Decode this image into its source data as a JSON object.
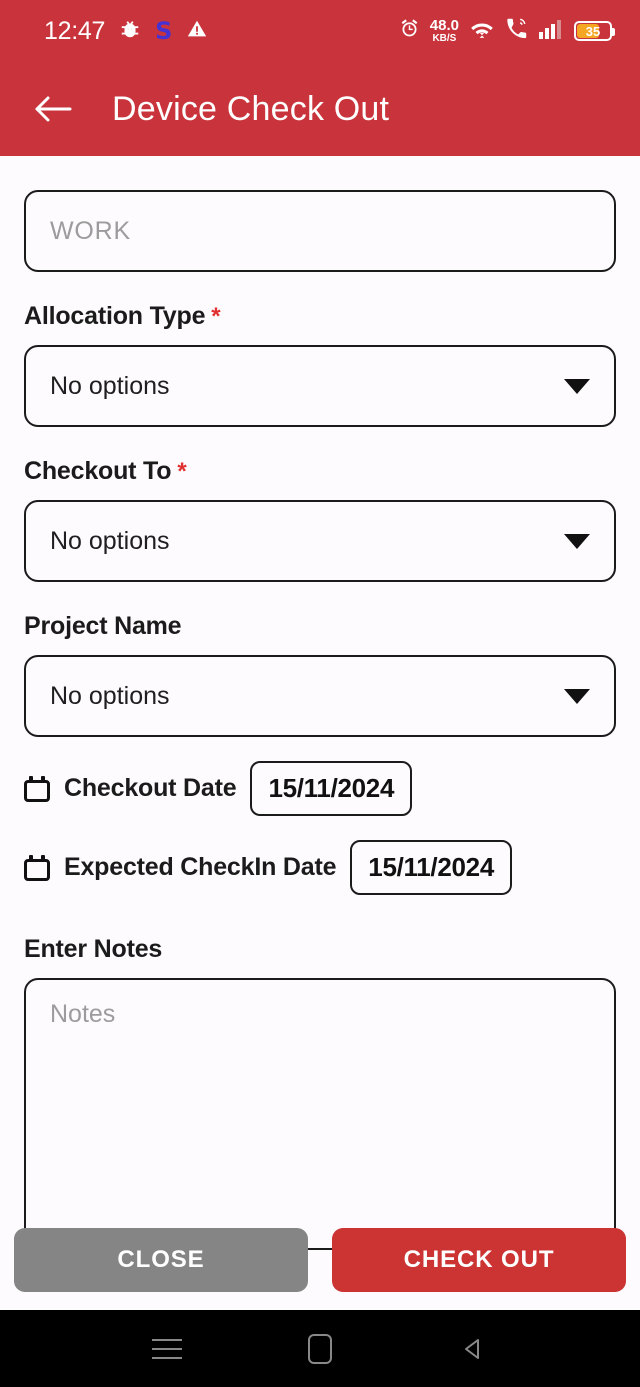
{
  "statusbar": {
    "time": "12:47",
    "icons": [
      "bug-icon",
      "samsung-pass-icon",
      "warning-icon"
    ],
    "network_speed_value": "48.0",
    "network_speed_unit": "KB/S",
    "right_icons": [
      "alarm-icon",
      "wifi-icon",
      "call-icon",
      "signal-icon"
    ],
    "battery_percent": "35"
  },
  "appbar": {
    "back_label": "←",
    "title": "Device Check Out"
  },
  "form": {
    "work_field": {
      "placeholder": "WORK",
      "value": ""
    },
    "allocation_type": {
      "label": "Allocation Type",
      "required_marker": "*",
      "value": "No options"
    },
    "checkout_to": {
      "label": "Checkout To",
      "required_marker": "*",
      "value": "No options"
    },
    "project_name": {
      "label": "Project Name",
      "value": "No options"
    },
    "checkout_date": {
      "label": "Checkout Date",
      "value": "15/11/2024"
    },
    "expected_checkin_date": {
      "label": "Expected CheckIn Date",
      "value": "15/11/2024"
    },
    "notes": {
      "label": "Enter Notes",
      "placeholder": "Notes",
      "value": ""
    }
  },
  "actions": {
    "close_label": "CLOSE",
    "submit_label": "CHECK OUT"
  },
  "navbar": {
    "recents": "recents-icon",
    "home": "home-icon",
    "back": "back-icon"
  },
  "colors": {
    "brand_red": "#c9343c",
    "button_red": "#cc3333",
    "close_gray": "#858585",
    "required_red": "#e03030",
    "battery_orange": "#f5a623"
  }
}
